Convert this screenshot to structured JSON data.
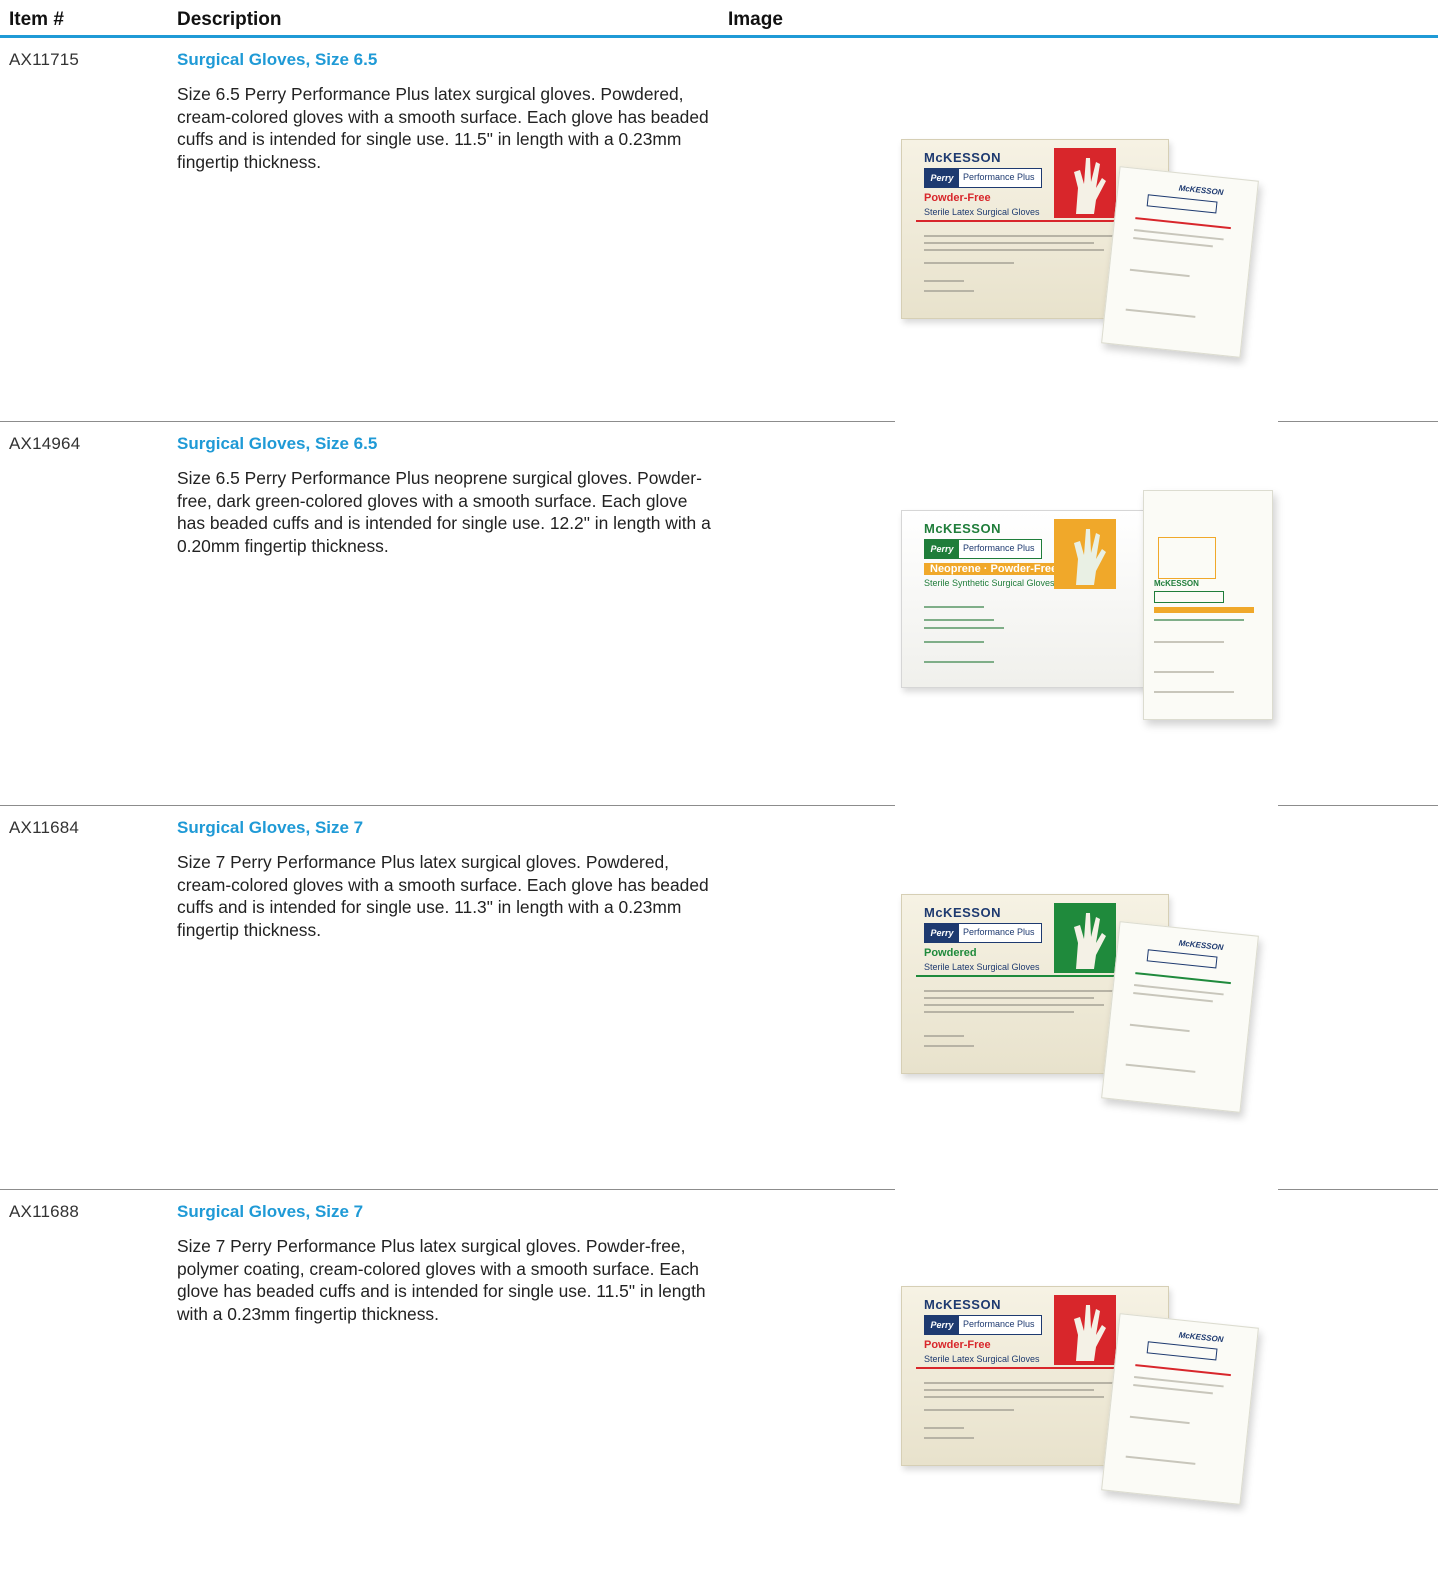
{
  "columns": {
    "item": "Item #",
    "description": "Description",
    "image": "Image"
  },
  "products": [
    {
      "item_no": "AX11715",
      "title": "Surgical Gloves, Size 6.5",
      "description": "Size 6.5 Perry Performance Plus latex surgical gloves. Powdered, cream-colored gloves with a smooth surface. Each glove has beaded cuffs and is intended for single use. 11.5\" in length with a 0.23mm fingertip thickness.",
      "image": {
        "brand": "McKESSON",
        "logo_badge": "Perry",
        "product_line": "Performance Plus",
        "variant": "Powder-Free",
        "subtitle": "Sterile Latex Surgical Gloves",
        "accent_color": "#d8262b"
      }
    },
    {
      "item_no": "AX14964",
      "title": "Surgical Gloves, Size 6.5",
      "description": "Size 6.5 Perry Performance Plus neoprene surgical gloves. Powder-free, dark green-colored gloves with a smooth surface. Each glove has beaded cuffs and is intended for single use. 12.2\" in length with a 0.20mm fingertip thickness.",
      "image": {
        "brand": "McKESSON",
        "logo_badge": "Perry",
        "product_line": "Performance Plus",
        "variant": "Neoprene · Powder-Free",
        "subtitle": "Sterile Synthetic Surgical Gloves, Smooth",
        "accent_color": "#f0a82a"
      }
    },
    {
      "item_no": "AX11684",
      "title": "Surgical Gloves, Size 7",
      "description": "Size 7 Perry Performance Plus latex surgical gloves. Powdered, cream-colored gloves with a smooth surface. Each glove has beaded cuffs and is intended for single use. 11.3\" in length with a 0.23mm fingertip thickness.",
      "image": {
        "brand": "McKESSON",
        "logo_badge": "Perry",
        "product_line": "Performance Plus",
        "variant": "Powdered",
        "subtitle": "Sterile Latex Surgical Gloves",
        "accent_color": "#1f8a3c"
      }
    },
    {
      "item_no": "AX11688",
      "title": "Surgical Gloves, Size 7",
      "description": "Size 7 Perry Performance Plus latex surgical gloves. Powder-free, polymer coating, cream-colored gloves with a smooth surface. Each glove has beaded cuffs and is intended for single use. 11.5\" in length with a 0.23mm fingertip thickness.",
      "image": {
        "brand": "McKESSON",
        "logo_badge": "Perry",
        "product_line": "Performance Plus",
        "variant": "Powder-Free",
        "subtitle": "Sterile Latex Surgical Gloves",
        "accent_color": "#d8262b"
      }
    }
  ]
}
